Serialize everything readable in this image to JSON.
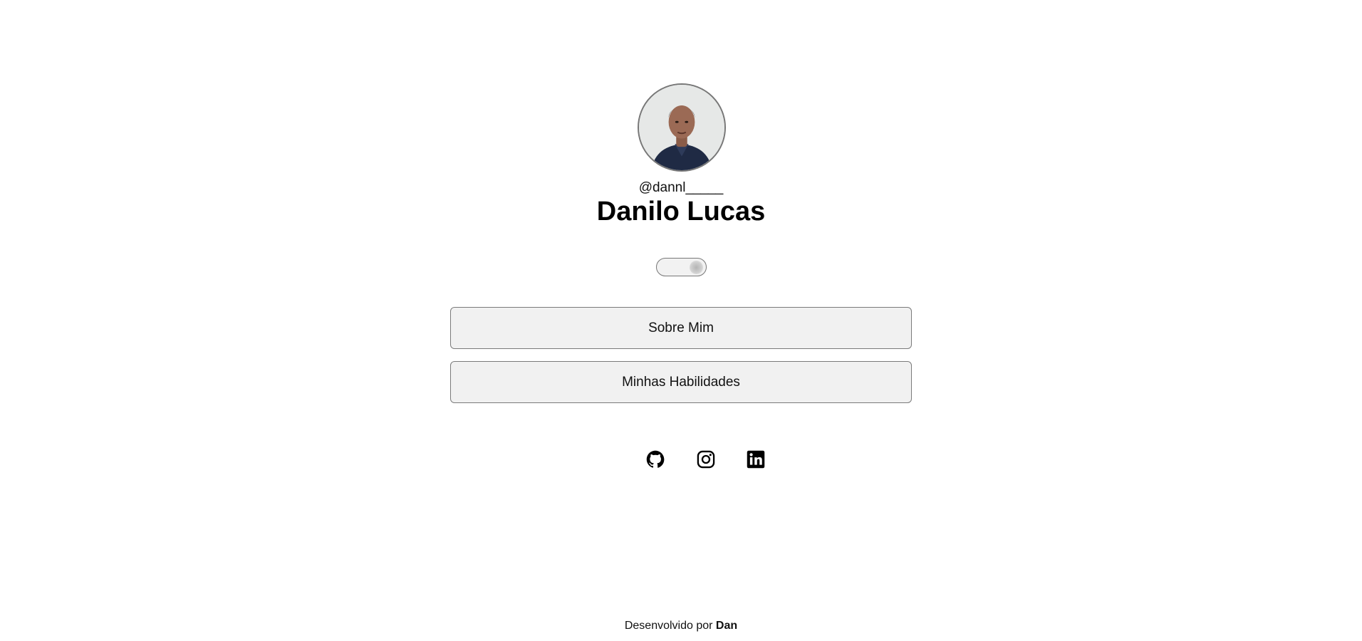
{
  "profile": {
    "avatar_alt": "profile photo",
    "handle": "@dannl_____",
    "name": "Danilo Lucas"
  },
  "theme_toggle": {
    "icon": "toggle-switch-icon",
    "state": "light"
  },
  "menu": {
    "items": [
      {
        "label": "Sobre Mim"
      },
      {
        "label": "Minhas Habilidades"
      }
    ]
  },
  "social": {
    "links": [
      {
        "icon": "github-icon"
      },
      {
        "icon": "instagram-icon"
      },
      {
        "icon": "linkedin-icon"
      }
    ]
  },
  "footer": {
    "text": "Desenvolvido por",
    "author": "Dan"
  },
  "colors": {
    "background": "#ffffff",
    "button_background": "#f1f1f1",
    "border": "#7a7a7a",
    "text": "#000000"
  }
}
